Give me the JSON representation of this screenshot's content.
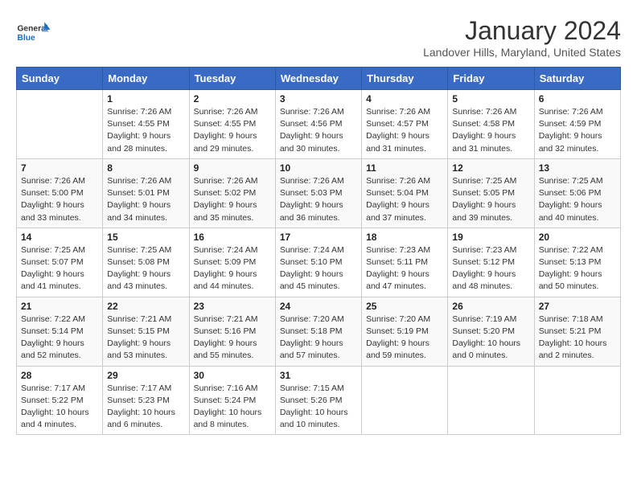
{
  "header": {
    "logo_general": "General",
    "logo_blue": "Blue",
    "month": "January 2024",
    "location": "Landover Hills, Maryland, United States"
  },
  "days_of_week": [
    "Sunday",
    "Monday",
    "Tuesday",
    "Wednesday",
    "Thursday",
    "Friday",
    "Saturday"
  ],
  "weeks": [
    [
      {
        "day": "",
        "info": ""
      },
      {
        "day": "1",
        "info": "Sunrise: 7:26 AM\nSunset: 4:55 PM\nDaylight: 9 hours\nand 28 minutes."
      },
      {
        "day": "2",
        "info": "Sunrise: 7:26 AM\nSunset: 4:55 PM\nDaylight: 9 hours\nand 29 minutes."
      },
      {
        "day": "3",
        "info": "Sunrise: 7:26 AM\nSunset: 4:56 PM\nDaylight: 9 hours\nand 30 minutes."
      },
      {
        "day": "4",
        "info": "Sunrise: 7:26 AM\nSunset: 4:57 PM\nDaylight: 9 hours\nand 31 minutes."
      },
      {
        "day": "5",
        "info": "Sunrise: 7:26 AM\nSunset: 4:58 PM\nDaylight: 9 hours\nand 31 minutes."
      },
      {
        "day": "6",
        "info": "Sunrise: 7:26 AM\nSunset: 4:59 PM\nDaylight: 9 hours\nand 32 minutes."
      }
    ],
    [
      {
        "day": "7",
        "info": "Sunrise: 7:26 AM\nSunset: 5:00 PM\nDaylight: 9 hours\nand 33 minutes."
      },
      {
        "day": "8",
        "info": "Sunrise: 7:26 AM\nSunset: 5:01 PM\nDaylight: 9 hours\nand 34 minutes."
      },
      {
        "day": "9",
        "info": "Sunrise: 7:26 AM\nSunset: 5:02 PM\nDaylight: 9 hours\nand 35 minutes."
      },
      {
        "day": "10",
        "info": "Sunrise: 7:26 AM\nSunset: 5:03 PM\nDaylight: 9 hours\nand 36 minutes."
      },
      {
        "day": "11",
        "info": "Sunrise: 7:26 AM\nSunset: 5:04 PM\nDaylight: 9 hours\nand 37 minutes."
      },
      {
        "day": "12",
        "info": "Sunrise: 7:25 AM\nSunset: 5:05 PM\nDaylight: 9 hours\nand 39 minutes."
      },
      {
        "day": "13",
        "info": "Sunrise: 7:25 AM\nSunset: 5:06 PM\nDaylight: 9 hours\nand 40 minutes."
      }
    ],
    [
      {
        "day": "14",
        "info": "Sunrise: 7:25 AM\nSunset: 5:07 PM\nDaylight: 9 hours\nand 41 minutes."
      },
      {
        "day": "15",
        "info": "Sunrise: 7:25 AM\nSunset: 5:08 PM\nDaylight: 9 hours\nand 43 minutes."
      },
      {
        "day": "16",
        "info": "Sunrise: 7:24 AM\nSunset: 5:09 PM\nDaylight: 9 hours\nand 44 minutes."
      },
      {
        "day": "17",
        "info": "Sunrise: 7:24 AM\nSunset: 5:10 PM\nDaylight: 9 hours\nand 45 minutes."
      },
      {
        "day": "18",
        "info": "Sunrise: 7:23 AM\nSunset: 5:11 PM\nDaylight: 9 hours\nand 47 minutes."
      },
      {
        "day": "19",
        "info": "Sunrise: 7:23 AM\nSunset: 5:12 PM\nDaylight: 9 hours\nand 48 minutes."
      },
      {
        "day": "20",
        "info": "Sunrise: 7:22 AM\nSunset: 5:13 PM\nDaylight: 9 hours\nand 50 minutes."
      }
    ],
    [
      {
        "day": "21",
        "info": "Sunrise: 7:22 AM\nSunset: 5:14 PM\nDaylight: 9 hours\nand 52 minutes."
      },
      {
        "day": "22",
        "info": "Sunrise: 7:21 AM\nSunset: 5:15 PM\nDaylight: 9 hours\nand 53 minutes."
      },
      {
        "day": "23",
        "info": "Sunrise: 7:21 AM\nSunset: 5:16 PM\nDaylight: 9 hours\nand 55 minutes."
      },
      {
        "day": "24",
        "info": "Sunrise: 7:20 AM\nSunset: 5:18 PM\nDaylight: 9 hours\nand 57 minutes."
      },
      {
        "day": "25",
        "info": "Sunrise: 7:20 AM\nSunset: 5:19 PM\nDaylight: 9 hours\nand 59 minutes."
      },
      {
        "day": "26",
        "info": "Sunrise: 7:19 AM\nSunset: 5:20 PM\nDaylight: 10 hours\nand 0 minutes."
      },
      {
        "day": "27",
        "info": "Sunrise: 7:18 AM\nSunset: 5:21 PM\nDaylight: 10 hours\nand 2 minutes."
      }
    ],
    [
      {
        "day": "28",
        "info": "Sunrise: 7:17 AM\nSunset: 5:22 PM\nDaylight: 10 hours\nand 4 minutes."
      },
      {
        "day": "29",
        "info": "Sunrise: 7:17 AM\nSunset: 5:23 PM\nDaylight: 10 hours\nand 6 minutes."
      },
      {
        "day": "30",
        "info": "Sunrise: 7:16 AM\nSunset: 5:24 PM\nDaylight: 10 hours\nand 8 minutes."
      },
      {
        "day": "31",
        "info": "Sunrise: 7:15 AM\nSunset: 5:26 PM\nDaylight: 10 hours\nand 10 minutes."
      },
      {
        "day": "",
        "info": ""
      },
      {
        "day": "",
        "info": ""
      },
      {
        "day": "",
        "info": ""
      }
    ]
  ]
}
